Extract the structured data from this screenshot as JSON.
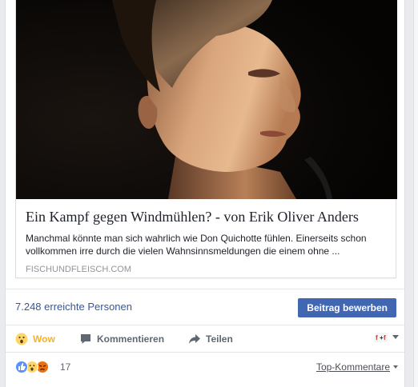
{
  "link_preview": {
    "title": "Ein Kampf gegen Windmühlen? - von Erik Oliver Anders",
    "description": "Manchmal könnte man sich wahrlich wie Don Quichotte fühlen. Einerseits schon vollkommen irre durch die vielen Wahnsinnsmeldungen die einem ohne ...",
    "domain": "FISCHUNDFLEISCH.COM"
  },
  "insights": {
    "reach_text": "7.248 erreichte Personen",
    "promote_label": "Beitrag bewerben"
  },
  "actions": {
    "wow_label": "Wow",
    "comment_label": "Kommentieren",
    "share_label": "Teilen"
  },
  "reactions": {
    "types": [
      "like",
      "wow",
      "angry"
    ],
    "count": "17",
    "sort_label": "Top-Kommentare"
  },
  "colors": {
    "link": "#365899",
    "brand_button": "#4267b2",
    "wow": "#f7b125",
    "muted": "#616770"
  }
}
